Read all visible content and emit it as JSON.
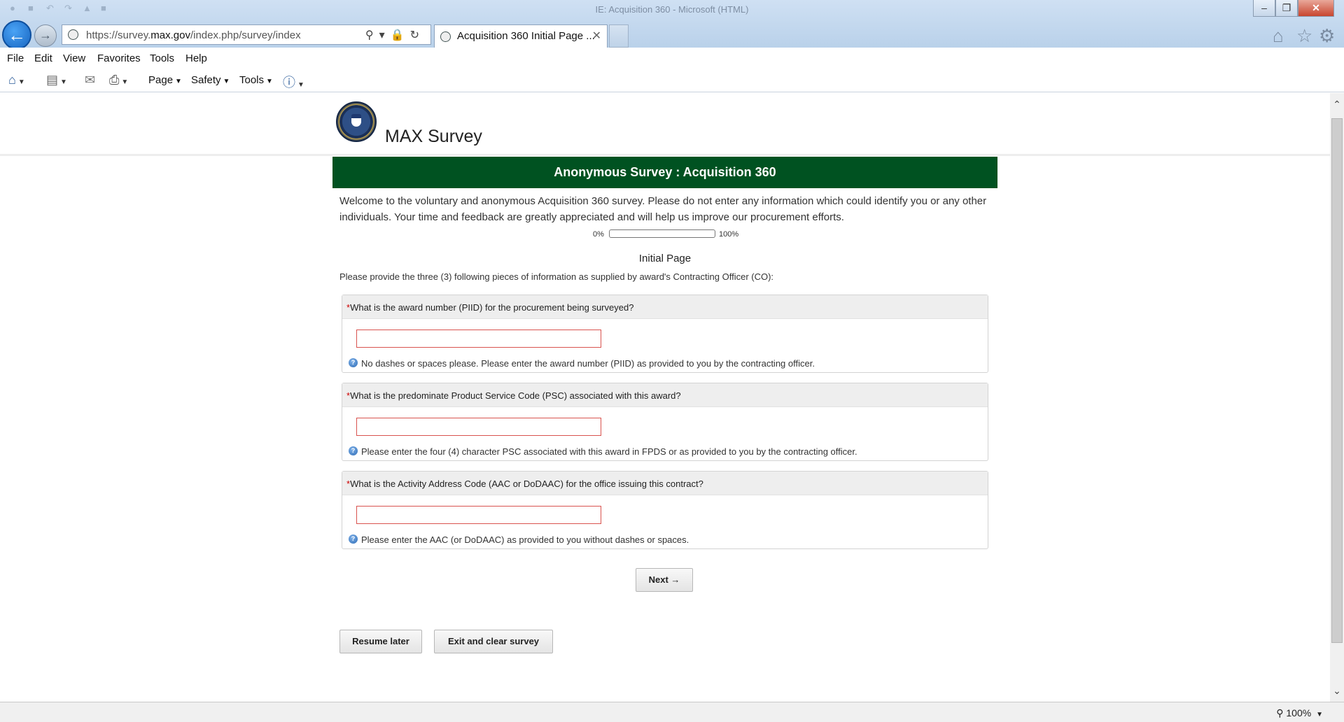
{
  "browser": {
    "window_title": "IE: Acquisition 360 - Microsoft (HTML)",
    "url_prefix": "https://survey.",
    "url_domain": "max.gov",
    "url_path": "/index.php/survey/index",
    "tab_title": "Acquisition 360 Initial Page ...",
    "menu": [
      "File",
      "Edit",
      "View",
      "Favorites",
      "Tools",
      "Help"
    ],
    "command_bar": {
      "page": "Page",
      "safety": "Safety",
      "tools": "Tools"
    },
    "zoom": "100%"
  },
  "site": {
    "title": "MAX Survey"
  },
  "survey": {
    "header": "Anonymous Survey : Acquisition 360",
    "welcome": "Welcome to the voluntary and anonymous Acquisition 360 survey. Please do not enter any information which could identify you or any other individuals. Your time and feedback are greatly appreciated and will help us improve our procurement efforts.",
    "progress": {
      "min_label": "0%",
      "max_label": "100%",
      "value_percent": 0
    },
    "page_name": "Initial Page",
    "instructions": "Please provide the three (3) following pieces of information as supplied by award's Contracting Officer (CO):",
    "questions": [
      {
        "required": "*",
        "text": "What is the award number (PIID) for the procurement being surveyed?",
        "value": "",
        "help": "No dashes or spaces please.  Please enter the award number (PIID) as provided to you by the contracting officer."
      },
      {
        "required": "*",
        "text": "What is the predominate Product Service Code (PSC) associated with this award?",
        "value": "",
        "help": "Please enter the four (4) character PSC associated with this award in FPDS or as provided to you by the contracting officer."
      },
      {
        "required": "*",
        "text": "What is the Activity Address Code (AAC or DoDAAC) for the office issuing this contract?",
        "value": "",
        "help": "Please enter the AAC (or DoDAAC) as provided to you without dashes or spaces."
      }
    ],
    "next_label": "Next →",
    "resume_label": "Resume later",
    "exit_label": "Exit and clear survey"
  },
  "colors": {
    "header_green": "#005221",
    "input_border_error": "#d9534f"
  }
}
